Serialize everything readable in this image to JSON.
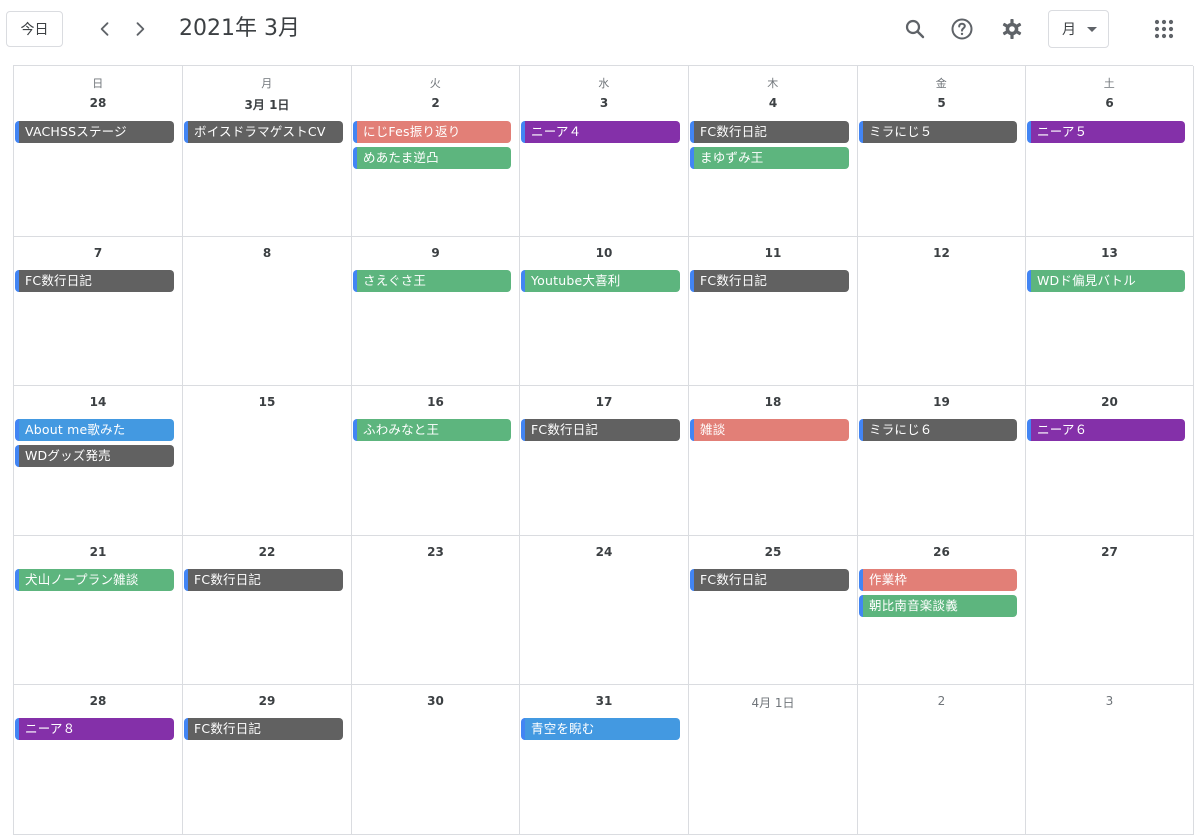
{
  "header": {
    "today_label": "今日",
    "title": "2021年 3月",
    "view_label": "月",
    "icons": [
      "chevron-left-icon",
      "chevron-right-icon",
      "search-icon",
      "help-icon",
      "gear-icon",
      "apps-grid-icon"
    ]
  },
  "colors": {
    "graphite": "#616161",
    "flamingo": "#e27f77",
    "sage": "#5db57e",
    "grape": "#8430a9",
    "peacock": "#4399e1",
    "accent": "#4285f4"
  },
  "weekdays": [
    "日",
    "月",
    "火",
    "水",
    "木",
    "金",
    "土"
  ],
  "weeks": [
    [
      {
        "label": "28",
        "other": false,
        "events": [
          {
            "title": "VACHSSステージ",
            "color": "graphite"
          }
        ]
      },
      {
        "label": "3月 1日",
        "other": false,
        "events": [
          {
            "title": "ボイスドラマゲストCV",
            "color": "graphite"
          }
        ]
      },
      {
        "label": "2",
        "other": false,
        "events": [
          {
            "title": "にじFes振り返り",
            "color": "flamingo"
          },
          {
            "title": "めあたま逆凸",
            "color": "sage"
          }
        ]
      },
      {
        "label": "3",
        "other": false,
        "events": [
          {
            "title": "ニーア４",
            "color": "grape"
          }
        ]
      },
      {
        "label": "4",
        "other": false,
        "events": [
          {
            "title": "FC数行日記",
            "color": "graphite"
          },
          {
            "title": "まゆずみ王",
            "color": "sage"
          }
        ]
      },
      {
        "label": "5",
        "other": false,
        "events": [
          {
            "title": "ミラにじ５",
            "color": "graphite"
          }
        ]
      },
      {
        "label": "6",
        "other": false,
        "events": [
          {
            "title": "ニーア５",
            "color": "grape"
          }
        ]
      }
    ],
    [
      {
        "label": "7",
        "other": false,
        "events": [
          {
            "title": "FC数行日記",
            "color": "graphite"
          }
        ]
      },
      {
        "label": "8",
        "other": false,
        "events": []
      },
      {
        "label": "9",
        "other": false,
        "events": [
          {
            "title": "さえぐさ王",
            "color": "sage"
          }
        ]
      },
      {
        "label": "10",
        "other": false,
        "events": [
          {
            "title": "Youtube大喜利",
            "color": "sage"
          }
        ]
      },
      {
        "label": "11",
        "other": false,
        "events": [
          {
            "title": "FC数行日記",
            "color": "graphite"
          }
        ]
      },
      {
        "label": "12",
        "other": false,
        "events": []
      },
      {
        "label": "13",
        "other": false,
        "events": [
          {
            "title": "WDド偏見バトル",
            "color": "sage"
          }
        ]
      }
    ],
    [
      {
        "label": "14",
        "other": false,
        "events": [
          {
            "title": "About me歌みた",
            "color": "peacock"
          },
          {
            "title": "WDグッズ発売",
            "color": "graphite"
          }
        ]
      },
      {
        "label": "15",
        "other": false,
        "events": []
      },
      {
        "label": "16",
        "other": false,
        "events": [
          {
            "title": "ふわみなと王",
            "color": "sage"
          }
        ]
      },
      {
        "label": "17",
        "other": false,
        "events": [
          {
            "title": "FC数行日記",
            "color": "graphite"
          }
        ]
      },
      {
        "label": "18",
        "other": false,
        "events": [
          {
            "title": "雑談",
            "color": "flamingo"
          }
        ]
      },
      {
        "label": "19",
        "other": false,
        "events": [
          {
            "title": "ミラにじ６",
            "color": "graphite"
          }
        ]
      },
      {
        "label": "20",
        "other": false,
        "events": [
          {
            "title": "ニーア６",
            "color": "grape"
          }
        ]
      }
    ],
    [
      {
        "label": "21",
        "other": false,
        "events": [
          {
            "title": "犬山ノープラン雑談",
            "color": "sage"
          }
        ]
      },
      {
        "label": "22",
        "other": false,
        "events": [
          {
            "title": "FC数行日記",
            "color": "graphite"
          }
        ]
      },
      {
        "label": "23",
        "other": false,
        "events": []
      },
      {
        "label": "24",
        "other": false,
        "events": []
      },
      {
        "label": "25",
        "other": false,
        "events": [
          {
            "title": "FC数行日記",
            "color": "graphite"
          }
        ]
      },
      {
        "label": "26",
        "other": false,
        "events": [
          {
            "title": "作業枠",
            "color": "flamingo"
          },
          {
            "title": "朝比南音楽談義",
            "color": "sage"
          }
        ]
      },
      {
        "label": "27",
        "other": false,
        "events": []
      }
    ],
    [
      {
        "label": "28",
        "other": false,
        "events": [
          {
            "title": "ニーア８",
            "color": "grape"
          }
        ]
      },
      {
        "label": "29",
        "other": false,
        "events": [
          {
            "title": "FC数行日記",
            "color": "graphite"
          }
        ]
      },
      {
        "label": "30",
        "other": false,
        "events": []
      },
      {
        "label": "31",
        "other": false,
        "events": [
          {
            "title": "青空を睨む",
            "color": "peacock"
          }
        ]
      },
      {
        "label": "4月 1日",
        "other": true,
        "events": []
      },
      {
        "label": "2",
        "other": true,
        "events": []
      },
      {
        "label": "3",
        "other": true,
        "events": []
      }
    ]
  ]
}
